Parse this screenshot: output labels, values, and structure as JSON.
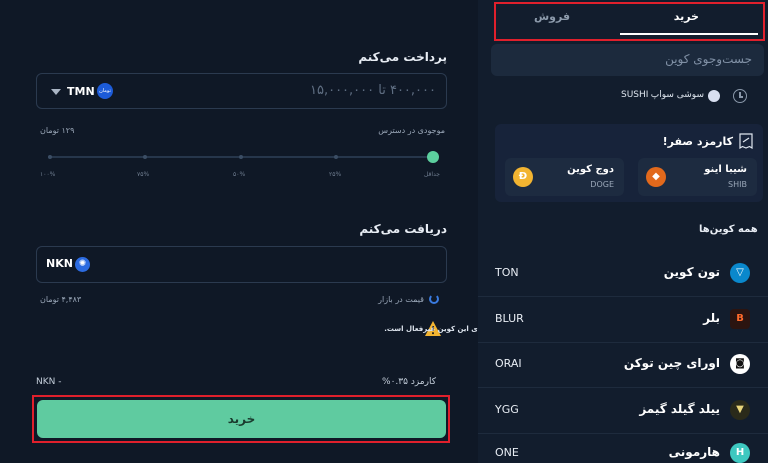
{
  "pay": {
    "title": "پرداخت می‌کنم",
    "amount_placeholder": "۴۰۰,۰۰۰ تا ۱۵,۰۰۰,۰۰۰",
    "currency_code": "TMN",
    "currency_badge": "تومان",
    "available_label": "موجودی در دسترس",
    "available_value": "۱۲۹ تومان",
    "slider_ticks": [
      "۱۰۰%",
      "۷۵%",
      "۵۰%",
      "۲۵%",
      "جداقل"
    ],
    "slider_level": 0
  },
  "receive": {
    "title": "دریافت می‌کنم",
    "currency_code": "NKN",
    "market_label": "قیمت در بازار",
    "market_value": "۴,۴۸۳ تومان"
  },
  "warning": {
    "text": "توجه داشته باشید که امکان برداشت، واریز و ثبت سفارش Limit برای این کوین غیرفعال است."
  },
  "fee": {
    "label": "کارمزد ۰.۳۵%",
    "value": "- NKN"
  },
  "buy_button": "خرید",
  "sidebar": {
    "tabs": [
      {
        "label": "خرید",
        "active": true
      },
      {
        "label": "فروش",
        "active": false
      }
    ],
    "search_placeholder": "جست‌وجوی کوین",
    "recent": {
      "name": "سوشی سواپ",
      "symbol": "SUSHI"
    },
    "zero_fee": {
      "title": "کارمزد صفر!",
      "coins": [
        {
          "name": "شیبا اینو",
          "symbol": "SHIB"
        },
        {
          "name": "دوج کوین",
          "symbol": "DOGE"
        }
      ]
    },
    "all_coins_title": "همه کوین‌ها",
    "coins": [
      {
        "name": "تون کوین",
        "symbol": "TON",
        "icon": "ton-icon",
        "color": "#0a88cc",
        "glyph": "▽"
      },
      {
        "name": "بلر",
        "symbol": "BLUR",
        "icon": "blur-icon",
        "color": "#2b1410",
        "glyph": "B"
      },
      {
        "name": "اورای چین توکن",
        "symbol": "ORAI",
        "icon": "orai-icon",
        "color": "#ffffff",
        "glyph": "◙"
      },
      {
        "name": "ییلد گیلد گیمز",
        "symbol": "YGG",
        "icon": "ygg-icon",
        "color": "#2a2a1a",
        "glyph": "▼"
      },
      {
        "name": "هارمونی",
        "symbol": "ONE",
        "icon": "one-icon",
        "color": "#3ec8c0",
        "glyph": "H"
      }
    ]
  },
  "colors": {
    "accent_green": "#5fcba0",
    "highlight_red": "#e0202c",
    "background": "#0f1826"
  }
}
